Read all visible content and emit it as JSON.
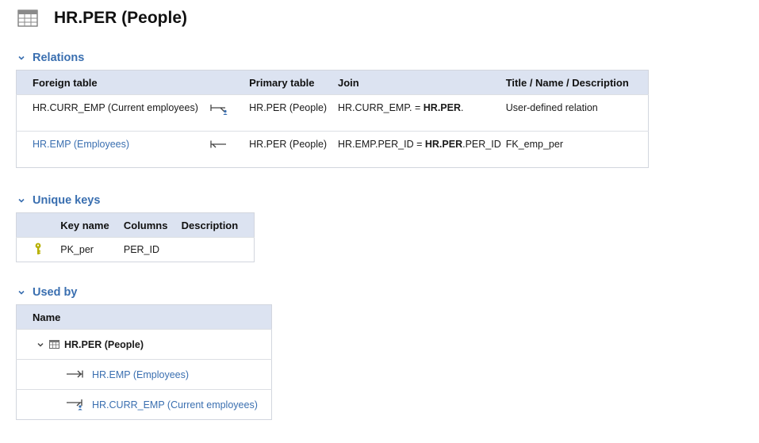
{
  "page": {
    "title": "HR.PER (People)",
    "icon": "table-icon"
  },
  "relations": {
    "section_title": "Relations",
    "columns": {
      "foreign": "Foreign table",
      "primary": "Primary table",
      "join": "Join",
      "title": "Title / Name / Description"
    },
    "rows": [
      {
        "foreign": "HR.CURR_EMP (Current employees)",
        "foreign_is_link": false,
        "relation_icon": "user-defined-relation-icon",
        "primary": "HR.PER (People)",
        "join_left": "HR.CURR_EMP. = ",
        "join_bold": "HR.PER",
        "join_right": ".",
        "title": "User-defined relation"
      },
      {
        "foreign": "HR.EMP (Employees)",
        "foreign_is_link": true,
        "relation_icon": "foreign-key-relation-icon",
        "primary": "HR.PER (People)",
        "join_left": "HR.EMP.PER_ID = ",
        "join_bold": "HR.PER",
        "join_right": ".PER_ID",
        "title": "FK_emp_per"
      }
    ]
  },
  "unique_keys": {
    "section_title": "Unique keys",
    "columns": {
      "key_name": "Key name",
      "columns": "Columns",
      "description": "Description"
    },
    "rows": [
      {
        "icon": "primary-key-icon",
        "key_name": "PK_per",
        "columns": "PER_ID",
        "description": ""
      }
    ]
  },
  "used_by": {
    "section_title": "Used by",
    "columns": {
      "name": "Name"
    },
    "root": {
      "label": "HR.PER (People)",
      "expanded": true,
      "icon": "table-icon"
    },
    "children": [
      {
        "label": "HR.EMP (Employees)",
        "icon": "foreign-key-relation-icon"
      },
      {
        "label": "HR.CURR_EMP (Current employees)",
        "icon": "user-defined-relation-icon"
      }
    ]
  },
  "colors": {
    "accent": "#3a6fb0",
    "header_bg": "#dce3f1",
    "border": "#d2d6de",
    "key_icon": "#b7b000",
    "user_icon": "#3a6fb0"
  }
}
